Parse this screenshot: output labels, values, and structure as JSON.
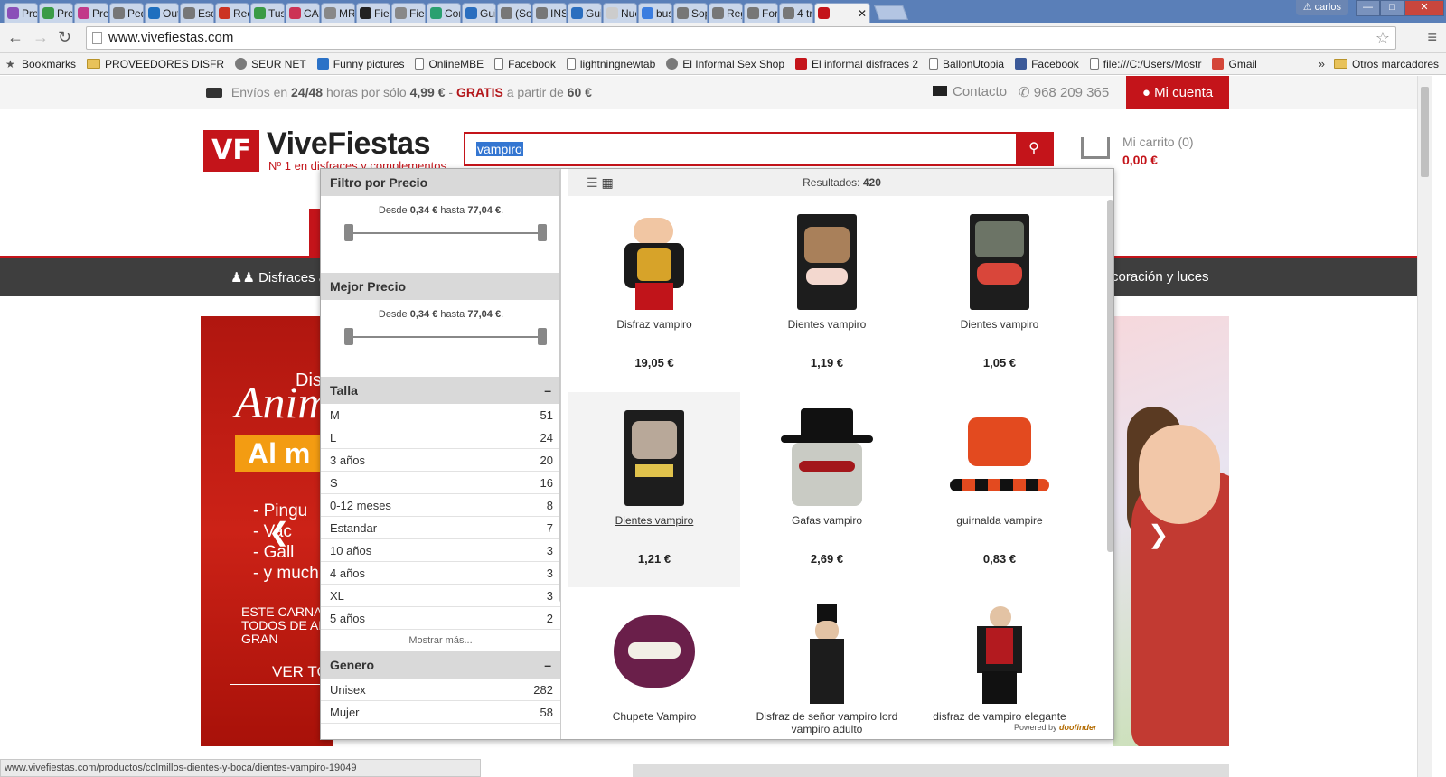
{
  "browser": {
    "tabs": [
      {
        "label": "Pro",
        "color": "#8a4fb8"
      },
      {
        "label": "Pre",
        "color": "#3a9b46"
      },
      {
        "label": "Pre",
        "color": "#c23a8a"
      },
      {
        "label": "Ped",
        "color": "#777777"
      },
      {
        "label": "Out",
        "color": "#1f6fbf"
      },
      {
        "label": "Esc",
        "color": "#777777"
      },
      {
        "label": "Rec",
        "color": "#cc3322"
      },
      {
        "label": "Tus",
        "color": "#3a9b46"
      },
      {
        "label": "CAR",
        "color": "#cc3355"
      },
      {
        "label": "MR",
        "color": "#888888"
      },
      {
        "label": "Fie",
        "color": "#222222"
      },
      {
        "label": "Fie",
        "color": "#888888"
      },
      {
        "label": "Con",
        "color": "#2aa070"
      },
      {
        "label": "Gui",
        "color": "#2a6ebf"
      },
      {
        "label": "(So",
        "color": "#777777"
      },
      {
        "label": "INS",
        "color": "#777777"
      },
      {
        "label": "Gui",
        "color": "#2a6ebf"
      },
      {
        "label": "Nueva",
        "color": "#cccccc"
      },
      {
        "label": "bus",
        "color": "#3b7de0"
      },
      {
        "label": "Sop",
        "color": "#777777"
      },
      {
        "label": "Reg",
        "color": "#777777"
      },
      {
        "label": "For",
        "color": "#777777"
      },
      {
        "label": "4 tr",
        "color": "#777777"
      }
    ],
    "active_tab": {
      "label": "VF",
      "color": "#c4141a",
      "close": "✕"
    },
    "user_label": "carlos",
    "url": "www.vivefiestas.com",
    "bookmarks": [
      {
        "label": "Bookmarks",
        "kind": "star"
      },
      {
        "label": "PROVEEDORES DISFR",
        "kind": "folder"
      },
      {
        "label": "SEUR NET",
        "kind": "globe"
      },
      {
        "label": "Funny pictures",
        "kind": "blue"
      },
      {
        "label": "OnlineMBE",
        "kind": "doc"
      },
      {
        "label": "Facebook",
        "kind": "doc"
      },
      {
        "label": "lightningnewtab",
        "kind": "doc"
      },
      {
        "label": "El Informal Sex Shop",
        "kind": "globe"
      },
      {
        "label": "El informal disfraces 2",
        "kind": "red"
      },
      {
        "label": "BallonUtopia",
        "kind": "doc"
      },
      {
        "label": "Facebook",
        "kind": "fb"
      },
      {
        "label": "file:///C:/Users/Mostr",
        "kind": "doc"
      },
      {
        "label": "Gmail",
        "kind": "gmail"
      }
    ],
    "bookmarks_more": "»",
    "other_bookmarks": "Otros marcadores",
    "status_url": "www.vivefiestas.com/productos/colmillos-dientes-y-boca/dientes-vampiro-19049"
  },
  "topbar": {
    "ship_a": "Envíos en ",
    "ship_b": "24/48",
    "ship_c": " horas por sólo ",
    "ship_d": "4,99 €",
    "ship_e": " - ",
    "ship_f": "GRATIS",
    "ship_g": " a partir de ",
    "ship_h": "60 €",
    "contact": "Contacto",
    "phone": "968 209 365",
    "account": "Mi cuenta"
  },
  "header": {
    "logo_mark": "VF",
    "logo_name": "ViveFiestas",
    "logo_tag": "Nº 1 en disfraces y complementos",
    "search_value": "vampiro",
    "cart_label": "Mi carrito (0)",
    "cart_total": "0,00 €"
  },
  "categories": {
    "left": "Disfraces ad",
    "right": "coración y luces"
  },
  "banner_left": {
    "l1": "Dis",
    "l2": "Anim",
    "l3": "Al m",
    "l4": "- Pingu\n- Vac\n- Gall\n- y much",
    "l5": "ESTE CARNA\nTODOS DE AN\nGRAN",
    "l6": "VER TO"
  },
  "filters": {
    "price_title": "Filtro por Precio",
    "price_range": {
      "prefix": "Desde ",
      "min": "0,34 €",
      "mid": " hasta ",
      "max": "77,04 €",
      "suffix": "."
    },
    "best_title": "Mejor Precio",
    "best_range": {
      "prefix": "Desde ",
      "min": "0,34 €",
      "mid": " hasta ",
      "max": "77,04 €",
      "suffix": "."
    },
    "size_title": "Talla",
    "sizes": [
      {
        "label": "M",
        "count": "51"
      },
      {
        "label": "L",
        "count": "24"
      },
      {
        "label": "3 años",
        "count": "20"
      },
      {
        "label": "S",
        "count": "16"
      },
      {
        "label": "0-12 meses",
        "count": "8"
      },
      {
        "label": "Estandar",
        "count": "7"
      },
      {
        "label": "10 años",
        "count": "3"
      },
      {
        "label": "4 años",
        "count": "3"
      },
      {
        "label": "XL",
        "count": "3"
      },
      {
        "label": "5 años",
        "count": "2"
      }
    ],
    "show_more": "Mostrar más...",
    "gender_title": "Genero",
    "genders": [
      {
        "label": "Unisex",
        "count": "282"
      },
      {
        "label": "Mujer",
        "count": "58"
      }
    ],
    "collapse_symbol": "–"
  },
  "results": {
    "label": "Resultados:",
    "count": "420",
    "products": [
      {
        "name": "Disfraz vampiro",
        "price": "19,05 €"
      },
      {
        "name": "Dientes vampiro",
        "price": "1,19 €"
      },
      {
        "name": "Dientes vampiro",
        "price": "1,05 €"
      },
      {
        "name": "Dientes vampiro",
        "price": "1,21 €"
      },
      {
        "name": "Gafas vampiro",
        "price": "2,69 €"
      },
      {
        "name": "guirnalda vampire",
        "price": "0,83 €"
      },
      {
        "name": "Chupete Vampiro",
        "price": ""
      },
      {
        "name": "Disfraz de señor vampiro lord vampiro adulto",
        "price": ""
      },
      {
        "name": "disfraz de vampiro elegante",
        "price": ""
      }
    ],
    "powered_a": "Powered by ",
    "powered_b": "doofinder"
  }
}
